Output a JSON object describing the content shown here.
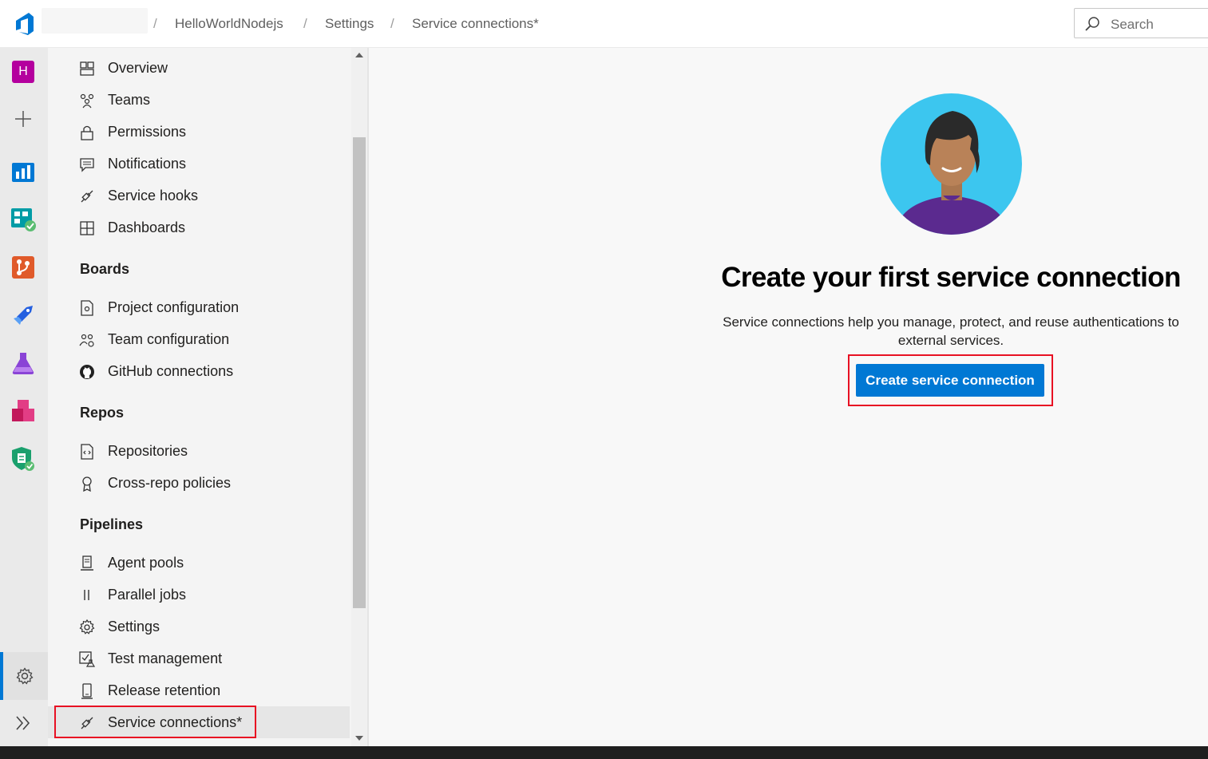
{
  "header": {
    "breadcrumbs": [
      "HelloWorldNodejs",
      "Settings",
      "Service connections*"
    ],
    "search_placeholder": "Search"
  },
  "rail": {
    "avatar_letter": "H"
  },
  "sidebar": {
    "general": [
      {
        "label": "Overview",
        "icon": "overview-icon"
      },
      {
        "label": "Teams",
        "icon": "teams-icon"
      },
      {
        "label": "Permissions",
        "icon": "lock-icon"
      },
      {
        "label": "Notifications",
        "icon": "notification-icon"
      },
      {
        "label": "Service hooks",
        "icon": "plug-icon"
      },
      {
        "label": "Dashboards",
        "icon": "dashboard-icon"
      }
    ],
    "boards_heading": "Boards",
    "boards": [
      {
        "label": "Project configuration",
        "icon": "project-config-icon"
      },
      {
        "label": "Team configuration",
        "icon": "team-config-icon"
      },
      {
        "label": "GitHub connections",
        "icon": "github-icon"
      }
    ],
    "repos_heading": "Repos",
    "repos": [
      {
        "label": "Repositories",
        "icon": "repo-icon"
      },
      {
        "label": "Cross-repo policies",
        "icon": "policy-badge-icon"
      }
    ],
    "pipelines_heading": "Pipelines",
    "pipelines": [
      {
        "label": "Agent pools",
        "icon": "agent-pool-icon"
      },
      {
        "label": "Parallel jobs",
        "icon": "parallel-icon"
      },
      {
        "label": "Settings",
        "icon": "gear-icon"
      },
      {
        "label": "Test management",
        "icon": "test-icon"
      },
      {
        "label": "Release retention",
        "icon": "phone-icon"
      },
      {
        "label": "Service connections*",
        "icon": "plug-icon"
      }
    ]
  },
  "main": {
    "title": "Create your first service connection",
    "description": "Service connections help you manage, protect, and reuse authentications to external services.",
    "button_label": "Create service connection"
  },
  "colors": {
    "accent": "#0078d4",
    "highlight": "#e81123"
  }
}
